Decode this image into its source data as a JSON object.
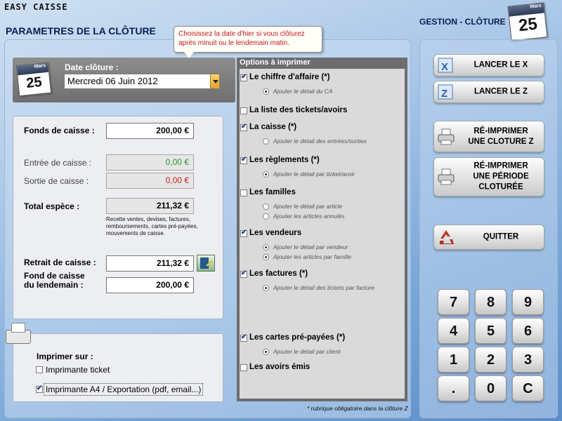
{
  "app": {
    "title": "EASY CAISSE"
  },
  "header": {
    "page_title": "PARAMETRES DE LA CLÔTURE",
    "section_title": "GESTION - CLÔTURE"
  },
  "calendar": {
    "month": "Mars",
    "day": "25"
  },
  "tooltip": {
    "text": "Choisissez la date d'hier si vous clôturez après minuit ou le lendemain matin."
  },
  "date": {
    "label": "Date clôture :",
    "value": "Mercredi 06 Juin 2012"
  },
  "cash": {
    "fonds_label": "Fonds de caisse :",
    "fonds_value": "200,00 €",
    "entree_label": "Entrée de caisse :",
    "entree_value": "0,00 €",
    "sortie_label": "Sortie de caisse :",
    "sortie_value": "0,00 €",
    "total_label": "Total espèce :",
    "total_value": "211,32 €",
    "total_note": "Recette ventes, devises, factures, remboursements, cartes pré-payées, mouvements de caisse.",
    "retrait_label": "Retrait de caisse :",
    "retrait_value": "211,32 €",
    "fond_lendemain_label_1": "Fond de caisse",
    "fond_lendemain_label_2": "du lendemain :",
    "fond_lendemain_value": "200,00 €"
  },
  "print": {
    "title": "Imprimer sur :",
    "ticket_label": "Imprimante ticket",
    "ticket_checked": false,
    "a4_label": "Imprimante A4 / Exportation (pdf, email...)",
    "a4_checked": true
  },
  "options": {
    "title": "Options à imprimer",
    "items": [
      {
        "label": "Le chiffre d'affaire (*)",
        "checked": true,
        "subs": [
          {
            "label": "Ajouter le détail du CA",
            "selected": true
          }
        ]
      },
      {
        "label": "La liste des tickets/avoirs",
        "checked": false,
        "subs": []
      },
      {
        "label": "La caisse  (*)",
        "checked": true,
        "subs": [
          {
            "label": "Ajouter le détail des entrées/sorties",
            "selected": false
          }
        ]
      },
      {
        "label": "Les règlements (*)",
        "checked": true,
        "subs": [
          {
            "label": "Ajouter le détail par ticket/avoir",
            "selected": true
          }
        ]
      },
      {
        "label": "Les familles",
        "checked": false,
        "subs": [
          {
            "label": "Ajouter le détail par article",
            "selected": false
          },
          {
            "label": "Ajouter les articles annulés",
            "selected": false
          }
        ]
      },
      {
        "label": "Les vendeurs",
        "checked": true,
        "subs": [
          {
            "label": "Ajouter le détail par vendeur",
            "selected": true
          },
          {
            "label": "Ajouter les articles par famille",
            "selected": true
          }
        ]
      },
      {
        "label": "Les factures (*)",
        "checked": true,
        "subs": [
          {
            "label": "Ajouter le détail des tickets par facture",
            "selected": true
          }
        ]
      },
      {
        "label": "Les cartes pré-payées (*)",
        "checked": true,
        "subs": [
          {
            "label": "Ajouter le détail par client",
            "selected": true
          }
        ]
      },
      {
        "label": "Les avoirs émis",
        "checked": false,
        "subs": []
      }
    ],
    "footnote": "* rubrique obligatoire dans la clôture Z"
  },
  "actions": {
    "lancer_x": "LANCER LE X",
    "lancer_z": "LANCER LE Z",
    "reimprimer_z": [
      "RÉ-IMPRIMER",
      "UNE CLOTURE Z"
    ],
    "reimprimer_periode": [
      "RÉ-IMPRIMER",
      "UNE PÉRIODE",
      "CLOTURÉE"
    ],
    "quitter": "QUITTER"
  },
  "keypad": {
    "keys": [
      "7",
      "8",
      "9",
      "4",
      "5",
      "6",
      "1",
      "2",
      "3",
      ".",
      "0",
      "C"
    ]
  },
  "colors": {
    "positive": "#2a9a2a",
    "negative": "#d01b1b",
    "header": "#0a1e55"
  }
}
